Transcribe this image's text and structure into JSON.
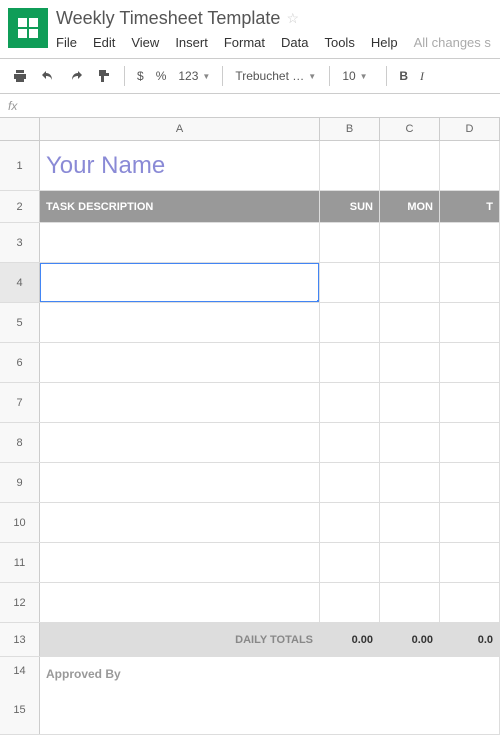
{
  "doc": {
    "title": "Weekly Timesheet Template",
    "save_status": "All changes s"
  },
  "menu": {
    "file": "File",
    "edit": "Edit",
    "view": "View",
    "insert": "Insert",
    "format": "Format",
    "data": "Data",
    "tools": "Tools",
    "help": "Help"
  },
  "toolbar": {
    "dollar": "$",
    "percent": "%",
    "num_format": "123",
    "font": "Trebuchet …",
    "font_size": "10",
    "bold": "B",
    "italic": "I"
  },
  "formula_bar": {
    "fx": "fx"
  },
  "columns": {
    "a": "A",
    "b": "B",
    "c": "C",
    "d": "D"
  },
  "rows": [
    "1",
    "2",
    "3",
    "4",
    "5",
    "6",
    "7",
    "8",
    "9",
    "10",
    "11",
    "12",
    "13",
    "14",
    "15"
  ],
  "sheet": {
    "title": "Your Name",
    "header_task": "TASK DESCRIPTION",
    "header_sun": "SUN",
    "header_mon": "MON",
    "header_tue_partial": "T",
    "daily_totals_label": "DAILY TOTALS",
    "total_sun": "0.00",
    "total_mon": "0.00",
    "total_tue": "0.0",
    "approved_by": "Approved By"
  }
}
